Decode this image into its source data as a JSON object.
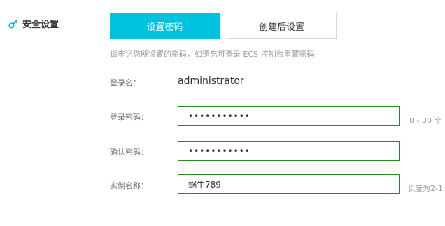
{
  "section": {
    "title": "安全设置",
    "icon": "key-icon"
  },
  "tabs": [
    {
      "label": "设置密码",
      "active": true
    },
    {
      "label": "创建后设置",
      "active": false
    }
  ],
  "hint": "请牢记您所设置的密码，如遗忘可登录 ECS 控制台重置密码",
  "form": {
    "login_name": {
      "label": "登录名：",
      "value": "administrator"
    },
    "password": {
      "label": "登录密码：",
      "value": "•••••••••••",
      "hint": "8 - 30 个"
    },
    "confirm_password": {
      "label": "确认密码：",
      "value": "•••••••••••"
    },
    "instance_name": {
      "label": "实例名称：",
      "value": "蜗牛789",
      "hint": "长度为2-1"
    }
  },
  "colors": {
    "primary": "#00c1de",
    "input_border": "#1e8e1e",
    "label": "#777777",
    "hint": "#999999"
  }
}
